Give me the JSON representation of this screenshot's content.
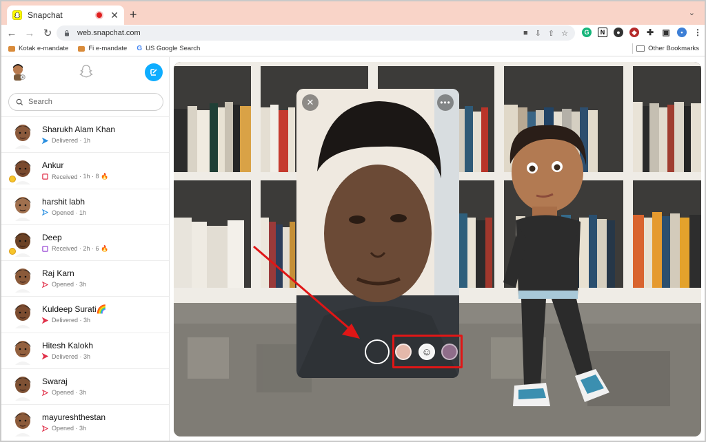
{
  "browser": {
    "tab_title": "Snapchat",
    "url": "web.snapchat.com",
    "bookmarks": [
      {
        "label": "Kotak e-mandate"
      },
      {
        "label": "Fi e-mandate"
      },
      {
        "label": "US Google Search"
      }
    ],
    "other_bookmarks": "Other Bookmarks"
  },
  "sidebar": {
    "search_placeholder": "Search",
    "chats": [
      {
        "name": "Sharukh Alam Khan",
        "status": "Delivered",
        "meta": "· 1h",
        "status_color": "#2a8fe0",
        "status_type": "sent-chat"
      },
      {
        "name": "Ankur",
        "status": "Received",
        "meta": "· 1h · 8 🔥",
        "status_color": "#e0314a",
        "status_type": "received-snap"
      },
      {
        "name": "harshit labh",
        "status": "Opened",
        "meta": "· 1h",
        "status_color": "#2a8fe0",
        "status_type": "opened-chat"
      },
      {
        "name": "Deep",
        "status": "Received",
        "meta": "· 2h · 6 🔥",
        "status_color": "#9b4bd6",
        "status_type": "received-video"
      },
      {
        "name": "Raj Karn",
        "status": "Opened",
        "meta": "· 3h",
        "status_color": "#e0314a",
        "status_type": "opened-snap"
      },
      {
        "name": "Kuldeep Surati🌈",
        "status": "Delivered",
        "meta": "· 3h",
        "status_color": "#e0314a",
        "status_type": "sent-snap"
      },
      {
        "name": "Hitesh Kalokh",
        "status": "Delivered",
        "meta": "· 3h",
        "status_color": "#e0314a",
        "status_type": "sent-snap"
      },
      {
        "name": "Swaraj",
        "status": "Opened",
        "meta": "· 3h",
        "status_color": "#e0314a",
        "status_type": "opened-snap"
      },
      {
        "name": "mayureshthestan",
        "status": "Opened",
        "meta": "· 3h",
        "status_color": "#e0314a",
        "status_type": "opened-snap"
      }
    ]
  },
  "camera": {
    "close_icon": "close-icon",
    "more_icon": "more-icon",
    "lenses": [
      "lens-peach",
      "lens-smiley",
      "lens-purple"
    ],
    "highlight_color": "#e01616"
  }
}
